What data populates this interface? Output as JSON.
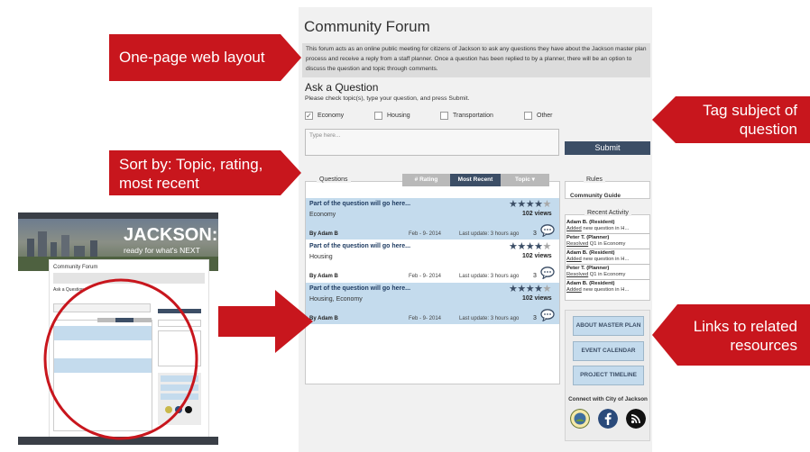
{
  "forum": {
    "title": "Community Forum",
    "intro": "This forum acts as an online public meeting for citizens of Jackson to ask any questions they have about the Jackson master plan process and receive a reply from a staff planner. Once a question has been replied to by a planner, there will be an option to discuss the question and topic through comments."
  },
  "ask": {
    "title": "Ask a Question",
    "instructions": "Please check topic(s), type your question, and press Submit.",
    "topics": [
      {
        "label": "Economy",
        "checked": true
      },
      {
        "label": "Housing",
        "checked": false
      },
      {
        "label": "Transportation",
        "checked": false
      },
      {
        "label": "Other",
        "checked": false
      }
    ],
    "placeholder": "Type here...",
    "submit_label": "Submit"
  },
  "questions": {
    "label": "Questions",
    "sort": {
      "rating": "# Rating",
      "recent": "Most Recent",
      "topic": "Topic ▾"
    },
    "items": [
      {
        "text": "Part of the question will go here...",
        "topic": "Economy",
        "rating": 4,
        "views": "102 views",
        "author": "By Adam B",
        "date": "Feb - 9- 2014",
        "update": "Last update: 3 hours ago",
        "comments": "3"
      },
      {
        "text": "Part of the question will go here...",
        "topic": "Housing",
        "rating": 4,
        "views": "102 views",
        "author": "By Adam B",
        "date": "Feb - 9- 2014",
        "update": "Last update: 3 hours ago",
        "comments": "3"
      },
      {
        "text": "Part of the question will go here...",
        "topic": "Housing, Economy",
        "rating": 4,
        "views": "102 views",
        "author": "By Adam B",
        "date": "Feb - 9- 2014",
        "update": "Last update: 3 hours ago",
        "comments": "3"
      }
    ]
  },
  "rules": {
    "label": "Rules",
    "link": "Community Guide"
  },
  "activity": {
    "label": "Recent Activity",
    "items": [
      {
        "who": "Adam B. (Resident)",
        "verb": "Added",
        "rest": " new question in H..."
      },
      {
        "who": "Peter T. (Planner)",
        "verb": "Resolved",
        "rest": " Q1 in Economy"
      },
      {
        "who": "Adam B. (Resident)",
        "verb": "Added",
        "rest": " new question in H..."
      },
      {
        "who": "Peter T. (Planner)",
        "verb": "Resolved",
        "rest": " Q1 in Economy"
      },
      {
        "who": "Adam B. (Resident)",
        "verb": "Added",
        "rest": " new question in H..."
      }
    ]
  },
  "links": {
    "buttons": [
      "ABOUT MASTER PLAN",
      "EVENT CALENDAR",
      "PROJECT TIMELINE"
    ],
    "connect": "Connect with City of Jackson"
  },
  "callouts": {
    "layout": "One-page web layout",
    "sort": [
      "Sort by: Topic, rating,",
      "most recent"
    ],
    "tag": [
      "Tag subject of",
      "question"
    ],
    "links": [
      "Links to related",
      "resources"
    ]
  },
  "thumbnail": {
    "brand": "JACKSON:",
    "tagline": "ready for what's NEXT"
  },
  "colors": {
    "accent": "#c8161d",
    "navy": "#3c4e66",
    "light_blue": "#c4dbed"
  },
  "icons": [
    "chat-bubble-icon",
    "star-icon",
    "checkbox-check-icon",
    "city-seal-icon",
    "facebook-icon",
    "rss-icon",
    "arrow-right-icon",
    "arrow-left-icon"
  ]
}
